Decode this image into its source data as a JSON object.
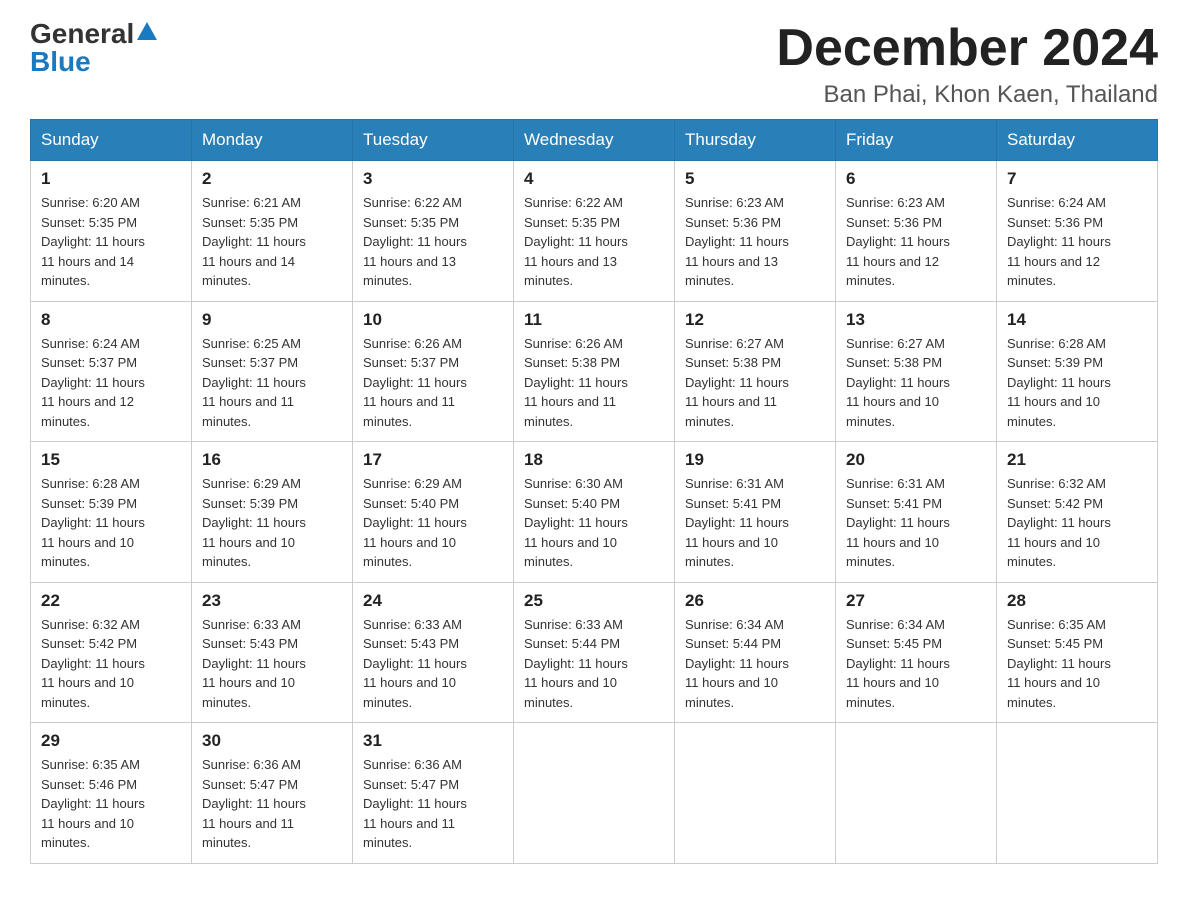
{
  "header": {
    "logo_general": "General",
    "logo_blue": "Blue",
    "month_title": "December 2024",
    "location": "Ban Phai, Khon Kaen, Thailand"
  },
  "days_of_week": [
    "Sunday",
    "Monday",
    "Tuesday",
    "Wednesday",
    "Thursday",
    "Friday",
    "Saturday"
  ],
  "weeks": [
    [
      {
        "day": "1",
        "sunrise": "6:20 AM",
        "sunset": "5:35 PM",
        "daylight": "11 hours and 14 minutes."
      },
      {
        "day": "2",
        "sunrise": "6:21 AM",
        "sunset": "5:35 PM",
        "daylight": "11 hours and 14 minutes."
      },
      {
        "day": "3",
        "sunrise": "6:22 AM",
        "sunset": "5:35 PM",
        "daylight": "11 hours and 13 minutes."
      },
      {
        "day": "4",
        "sunrise": "6:22 AM",
        "sunset": "5:35 PM",
        "daylight": "11 hours and 13 minutes."
      },
      {
        "day": "5",
        "sunrise": "6:23 AM",
        "sunset": "5:36 PM",
        "daylight": "11 hours and 13 minutes."
      },
      {
        "day": "6",
        "sunrise": "6:23 AM",
        "sunset": "5:36 PM",
        "daylight": "11 hours and 12 minutes."
      },
      {
        "day": "7",
        "sunrise": "6:24 AM",
        "sunset": "5:36 PM",
        "daylight": "11 hours and 12 minutes."
      }
    ],
    [
      {
        "day": "8",
        "sunrise": "6:24 AM",
        "sunset": "5:37 PM",
        "daylight": "11 hours and 12 minutes."
      },
      {
        "day": "9",
        "sunrise": "6:25 AM",
        "sunset": "5:37 PM",
        "daylight": "11 hours and 11 minutes."
      },
      {
        "day": "10",
        "sunrise": "6:26 AM",
        "sunset": "5:37 PM",
        "daylight": "11 hours and 11 minutes."
      },
      {
        "day": "11",
        "sunrise": "6:26 AM",
        "sunset": "5:38 PM",
        "daylight": "11 hours and 11 minutes."
      },
      {
        "day": "12",
        "sunrise": "6:27 AM",
        "sunset": "5:38 PM",
        "daylight": "11 hours and 11 minutes."
      },
      {
        "day": "13",
        "sunrise": "6:27 AM",
        "sunset": "5:38 PM",
        "daylight": "11 hours and 10 minutes."
      },
      {
        "day": "14",
        "sunrise": "6:28 AM",
        "sunset": "5:39 PM",
        "daylight": "11 hours and 10 minutes."
      }
    ],
    [
      {
        "day": "15",
        "sunrise": "6:28 AM",
        "sunset": "5:39 PM",
        "daylight": "11 hours and 10 minutes."
      },
      {
        "day": "16",
        "sunrise": "6:29 AM",
        "sunset": "5:39 PM",
        "daylight": "11 hours and 10 minutes."
      },
      {
        "day": "17",
        "sunrise": "6:29 AM",
        "sunset": "5:40 PM",
        "daylight": "11 hours and 10 minutes."
      },
      {
        "day": "18",
        "sunrise": "6:30 AM",
        "sunset": "5:40 PM",
        "daylight": "11 hours and 10 minutes."
      },
      {
        "day": "19",
        "sunrise": "6:31 AM",
        "sunset": "5:41 PM",
        "daylight": "11 hours and 10 minutes."
      },
      {
        "day": "20",
        "sunrise": "6:31 AM",
        "sunset": "5:41 PM",
        "daylight": "11 hours and 10 minutes."
      },
      {
        "day": "21",
        "sunrise": "6:32 AM",
        "sunset": "5:42 PM",
        "daylight": "11 hours and 10 minutes."
      }
    ],
    [
      {
        "day": "22",
        "sunrise": "6:32 AM",
        "sunset": "5:42 PM",
        "daylight": "11 hours and 10 minutes."
      },
      {
        "day": "23",
        "sunrise": "6:33 AM",
        "sunset": "5:43 PM",
        "daylight": "11 hours and 10 minutes."
      },
      {
        "day": "24",
        "sunrise": "6:33 AM",
        "sunset": "5:43 PM",
        "daylight": "11 hours and 10 minutes."
      },
      {
        "day": "25",
        "sunrise": "6:33 AM",
        "sunset": "5:44 PM",
        "daylight": "11 hours and 10 minutes."
      },
      {
        "day": "26",
        "sunrise": "6:34 AM",
        "sunset": "5:44 PM",
        "daylight": "11 hours and 10 minutes."
      },
      {
        "day": "27",
        "sunrise": "6:34 AM",
        "sunset": "5:45 PM",
        "daylight": "11 hours and 10 minutes."
      },
      {
        "day": "28",
        "sunrise": "6:35 AM",
        "sunset": "5:45 PM",
        "daylight": "11 hours and 10 minutes."
      }
    ],
    [
      {
        "day": "29",
        "sunrise": "6:35 AM",
        "sunset": "5:46 PM",
        "daylight": "11 hours and 10 minutes."
      },
      {
        "day": "30",
        "sunrise": "6:36 AM",
        "sunset": "5:47 PM",
        "daylight": "11 hours and 11 minutes."
      },
      {
        "day": "31",
        "sunrise": "6:36 AM",
        "sunset": "5:47 PM",
        "daylight": "11 hours and 11 minutes."
      },
      null,
      null,
      null,
      null
    ]
  ],
  "labels": {
    "sunrise_prefix": "Sunrise: ",
    "sunset_prefix": "Sunset: ",
    "daylight_prefix": "Daylight: "
  }
}
